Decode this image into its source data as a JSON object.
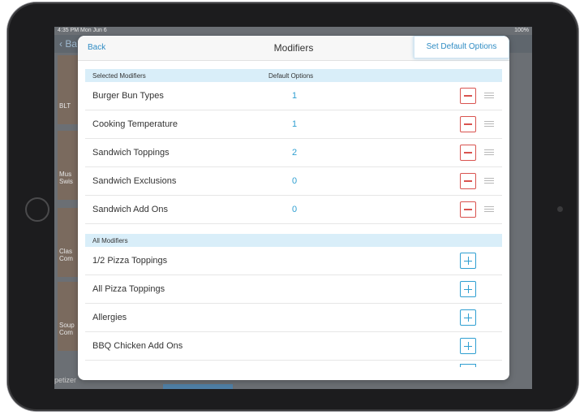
{
  "statusbar": {
    "time": "4:35 PM  Mon Jun 6",
    "battery": "100%"
  },
  "background": {
    "back_label": "‹ Ba",
    "tiles": [
      "BLT",
      "Mus Swis",
      "Clas Com",
      "Soup Com"
    ],
    "footer_label": "petizer"
  },
  "modal": {
    "title": "Modifiers",
    "back_label": "Back",
    "set_default_label": "Set Default Options",
    "selected": {
      "header_name": "Selected Modifiers",
      "header_default": "Default Options",
      "items": [
        {
          "name": "Burger Bun Types",
          "count": "1"
        },
        {
          "name": "Cooking Temperature",
          "count": "1"
        },
        {
          "name": "Sandwich Toppings",
          "count": "2"
        },
        {
          "name": "Sandwich Exclusions",
          "count": "0"
        },
        {
          "name": "Sandwich Add Ons",
          "count": "0"
        }
      ]
    },
    "all": {
      "header_name": "All Modifiers",
      "items": [
        {
          "name": "1/2 Pizza Toppings"
        },
        {
          "name": "All Pizza Toppings"
        },
        {
          "name": "Allergies"
        },
        {
          "name": "BBQ Chicken Add Ons"
        }
      ]
    }
  },
  "colors": {
    "accent": "#2f8cc4",
    "count_blue": "#2f9fd1",
    "remove_red": "#d9534f",
    "section_header_bg": "#d9eef9"
  }
}
